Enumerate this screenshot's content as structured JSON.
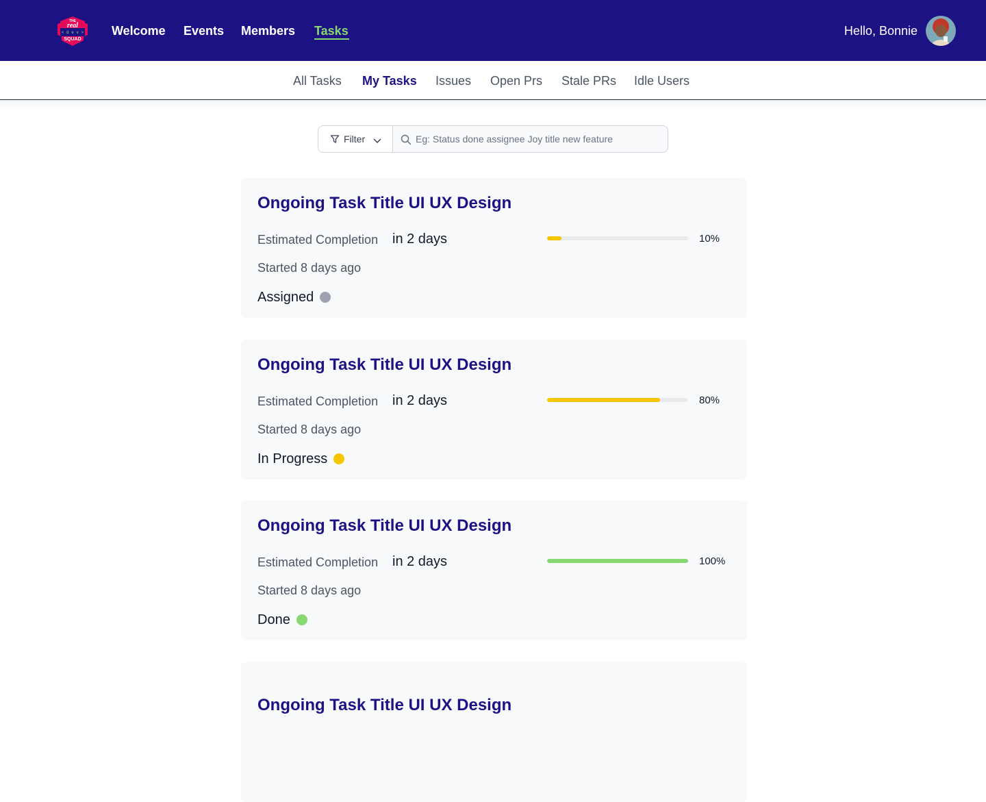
{
  "header": {
    "logo": {
      "name": "real-dev-squad-logo",
      "lines": [
        "THE",
        "real",
        "< d e v >",
        "SQUAD"
      ]
    },
    "nav": [
      {
        "label": "Welcome",
        "active": false
      },
      {
        "label": "Events",
        "active": false
      },
      {
        "label": "Members",
        "active": false
      },
      {
        "label": "Tasks",
        "active": true
      }
    ],
    "greeting": "Hello, Bonnie",
    "avatar_icon": "user-avatar"
  },
  "subnav": {
    "items": [
      {
        "label": "All Tasks",
        "active": false
      },
      {
        "label": "My Tasks",
        "active": true
      },
      {
        "label": "Issues",
        "active": false
      },
      {
        "label": "Open Prs",
        "active": false
      },
      {
        "label": "Stale PRs",
        "active": false
      },
      {
        "label": "Idle Users",
        "active": false
      }
    ]
  },
  "search": {
    "filter_label": "Filter",
    "filter_icon": "funnel-icon",
    "chevron_icon": "chevron-down-icon",
    "search_icon": "magnifier-icon",
    "placeholder": "Eg: Status done assignee Joy title new feature",
    "value": ""
  },
  "tasks": [
    {
      "title": "Ongoing Task Title UI UX Design",
      "est_label": "Estimated Completion",
      "est_value": "in 2 days",
      "started": "Started 8 days ago",
      "status": "Assigned",
      "status_color": "#9ca3af",
      "progress": 10,
      "progress_label": "10%",
      "progress_color": "#f6c500"
    },
    {
      "title": "Ongoing Task Title UI UX Design",
      "est_label": "Estimated Completion",
      "est_value": "in 2 days",
      "started": "Started 8 days ago",
      "status": "In Progress",
      "status_color": "#f6c500",
      "progress": 80,
      "progress_label": "80%",
      "progress_color": "#f6c500"
    },
    {
      "title": "Ongoing Task Title UI UX Design",
      "est_label": "Estimated Completion",
      "est_value": "in 2 days",
      "started": "Started 8 days ago",
      "status": "Done",
      "status_color": "#87d870",
      "progress": 100,
      "progress_label": "100%",
      "progress_color": "#87d870"
    },
    {
      "title": "Ongoing Task Title UI UX Design"
    }
  ],
  "colors": {
    "brand_navy": "#1d1283",
    "accent_green": "#87d870",
    "progress_yellow": "#f6c500",
    "status_grey": "#9ca3af"
  }
}
